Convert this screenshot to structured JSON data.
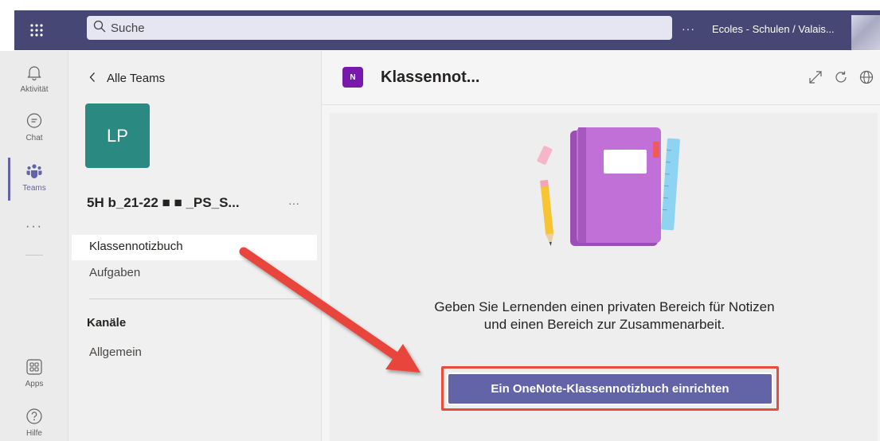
{
  "search": {
    "placeholder": "Suche"
  },
  "topbar": {
    "more": "···",
    "tenant": "Ecoles - Schulen / Valais..."
  },
  "rail": {
    "items": [
      {
        "label": "Aktivität",
        "icon": "bell-icon"
      },
      {
        "label": "Chat",
        "icon": "chat-icon"
      },
      {
        "label": "Teams",
        "icon": "teams-icon",
        "active": true
      },
      {
        "label": "Apps",
        "icon": "apps-icon"
      },
      {
        "label": "Hilfe",
        "icon": "help-icon"
      }
    ],
    "more": "···"
  },
  "teampane": {
    "back_label": "Alle Teams",
    "avatar_initials": "LP",
    "team_name": "5H b_21-22 ■ ■ _PS_S...",
    "more": "···",
    "nav": [
      {
        "label": "Klassennotizbuch",
        "selected": true
      },
      {
        "label": "Aufgaben"
      }
    ],
    "channels_heading": "Kanäle",
    "channels": [
      {
        "label": "Allgemein"
      }
    ]
  },
  "main": {
    "title": "Klassennot...",
    "description_line1": "Geben Sie Lernenden einen privaten Bereich für Notizen",
    "description_line2": "und einen Bereich zur Zusammenarbeit.",
    "button_label": "Ein OneNote-Klassennotizbuch einrichten"
  },
  "colors": {
    "topbar": "#464775",
    "accent": "#6264a7",
    "team_avatar": "#2a8a82",
    "annotation": "#e84c3d"
  }
}
